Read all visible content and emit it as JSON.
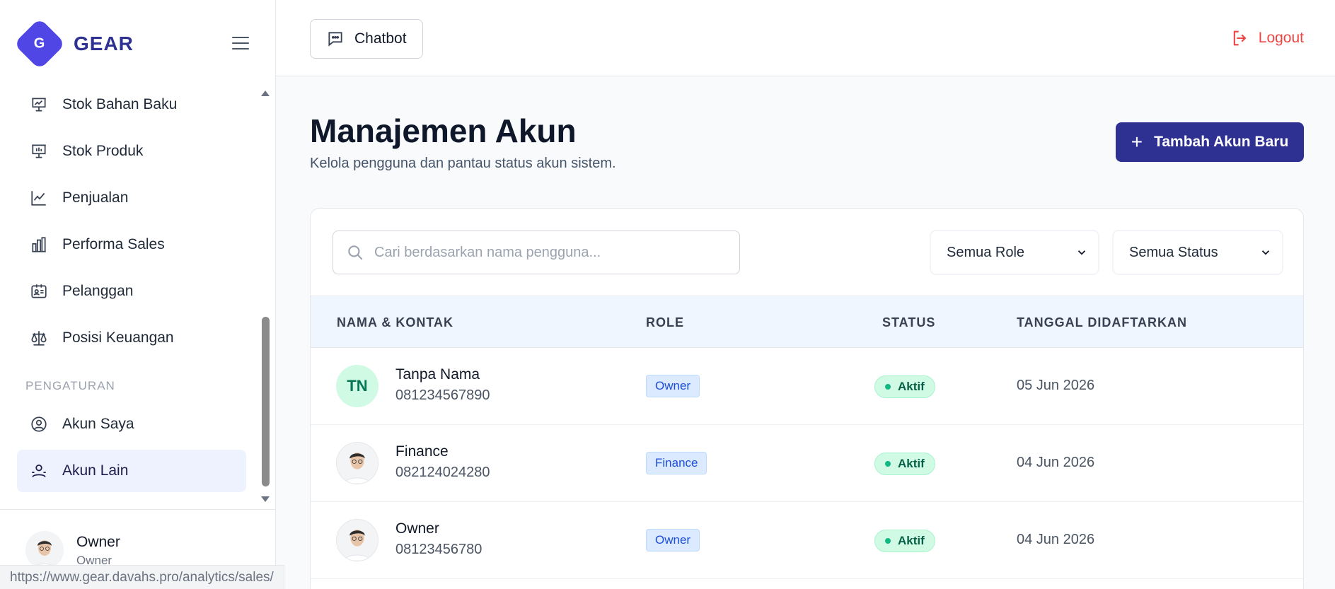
{
  "app": {
    "brand_letter": "G",
    "brand_name": "GEAR",
    "accent": "#2e3192"
  },
  "sidebar": {
    "items": [
      {
        "label": "Stok Bahan Baku",
        "icon": "presentation-chart-icon"
      },
      {
        "label": "Stok Produk",
        "icon": "presentation-board-icon"
      },
      {
        "label": "Penjualan",
        "icon": "trend-line-icon"
      },
      {
        "label": "Performa Sales",
        "icon": "bar-chart-icon"
      },
      {
        "label": "Pelanggan",
        "icon": "id-card-icon"
      },
      {
        "label": "Posisi Keuangan",
        "icon": "scale-icon"
      }
    ],
    "section_label": "PENGATURAN",
    "settings_items": [
      {
        "label": "Akun Saya",
        "icon": "user-circle-icon"
      },
      {
        "label": "Akun Lain",
        "icon": "users-icon",
        "active": true
      }
    ],
    "user": {
      "name": "Owner",
      "role": "Owner"
    }
  },
  "status_bar_url": "https://www.gear.davahs.pro/analytics/sales/",
  "topbar": {
    "chatbot_label": "Chatbot",
    "logout_label": "Logout",
    "logout_color": "#ef4444"
  },
  "main": {
    "title": "Manajemen Akun",
    "subtitle": "Kelola pengguna dan pantau status akun sistem.",
    "add_button": "Tambah Akun Baru",
    "search_placeholder": "Cari berdasarkan nama pengguna...",
    "role_filter": "Semua Role",
    "status_filter": "Semua Status",
    "columns": [
      "NAMA & KONTAK",
      "ROLE",
      "STATUS",
      "TANGGAL DIDAFTARKAN"
    ],
    "rows": [
      {
        "initials": "TN",
        "name": "Tanpa Nama",
        "phone": "081234567890",
        "role": "Owner",
        "status": "Aktif",
        "date": "05 Jun 2026"
      },
      {
        "initials": "",
        "name": "Finance",
        "phone": "082124024280",
        "role": "Finance",
        "status": "Aktif",
        "date": "04 Jun 2026"
      },
      {
        "initials": "",
        "name": "Owner",
        "phone": "08123456780",
        "role": "Owner",
        "status": "Aktif",
        "date": "04 Jun 2026"
      }
    ]
  }
}
